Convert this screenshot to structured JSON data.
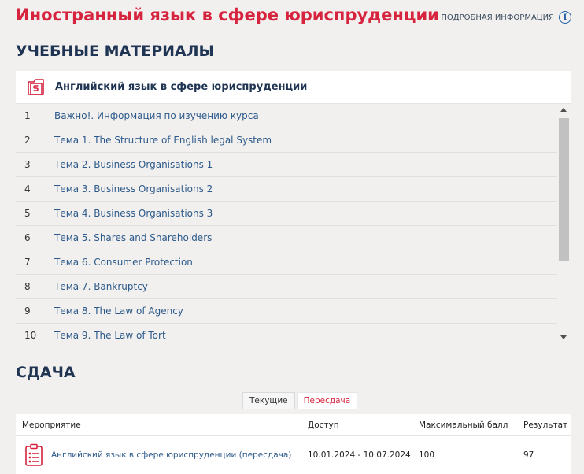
{
  "header": {
    "title": "Иностранный язык в сфере юриспруденции",
    "info_link": "ПОДРОБНАЯ ИНФОРМАЦИЯ",
    "info_icon_glyph": "i"
  },
  "materials": {
    "heading": "УЧЕБНЫЕ МАТЕРИАЛЫ",
    "course_title": "Английский язык в сфере юриспруденции",
    "topics": [
      {
        "num": "1",
        "label": "Важно!. Информация по изучению курса"
      },
      {
        "num": "2",
        "label": "Тема 1. The Structure of English legal System"
      },
      {
        "num": "3",
        "label": "Тема 2. Business Organisations 1"
      },
      {
        "num": "4",
        "label": "Тема 3. Business Organisations 2"
      },
      {
        "num": "5",
        "label": "Тема 4. Business Organisations 3"
      },
      {
        "num": "6",
        "label": "Тема 5. Shares and Shareholders"
      },
      {
        "num": "7",
        "label": "Тема 6. Consumer Protection"
      },
      {
        "num": "8",
        "label": "Тема 7. Bankruptcy"
      },
      {
        "num": "9",
        "label": "Тема 8. The Law of Agency"
      },
      {
        "num": "10",
        "label": "Тема 9. The Law of Tort"
      }
    ]
  },
  "exam": {
    "heading": "СДАЧА",
    "tabs": {
      "current": "Текущие",
      "retake": "Пересдача"
    },
    "columns": {
      "event": "Мероприятие",
      "access": "Доступ",
      "max": "Максимальный балл",
      "result": "Результат"
    },
    "rows": [
      {
        "event": "Английский язык в сфере юриспруденции (пересдача)",
        "access": "10.01.2024 - 10.07.2024",
        "max": "100",
        "result": "97"
      }
    ]
  },
  "colors": {
    "accent": "#d6243f",
    "heading": "#203553",
    "link": "#2d5a8a"
  },
  "icons": {
    "course": "document-icon",
    "exam": "clipboard-icon",
    "info": "info-icon"
  }
}
